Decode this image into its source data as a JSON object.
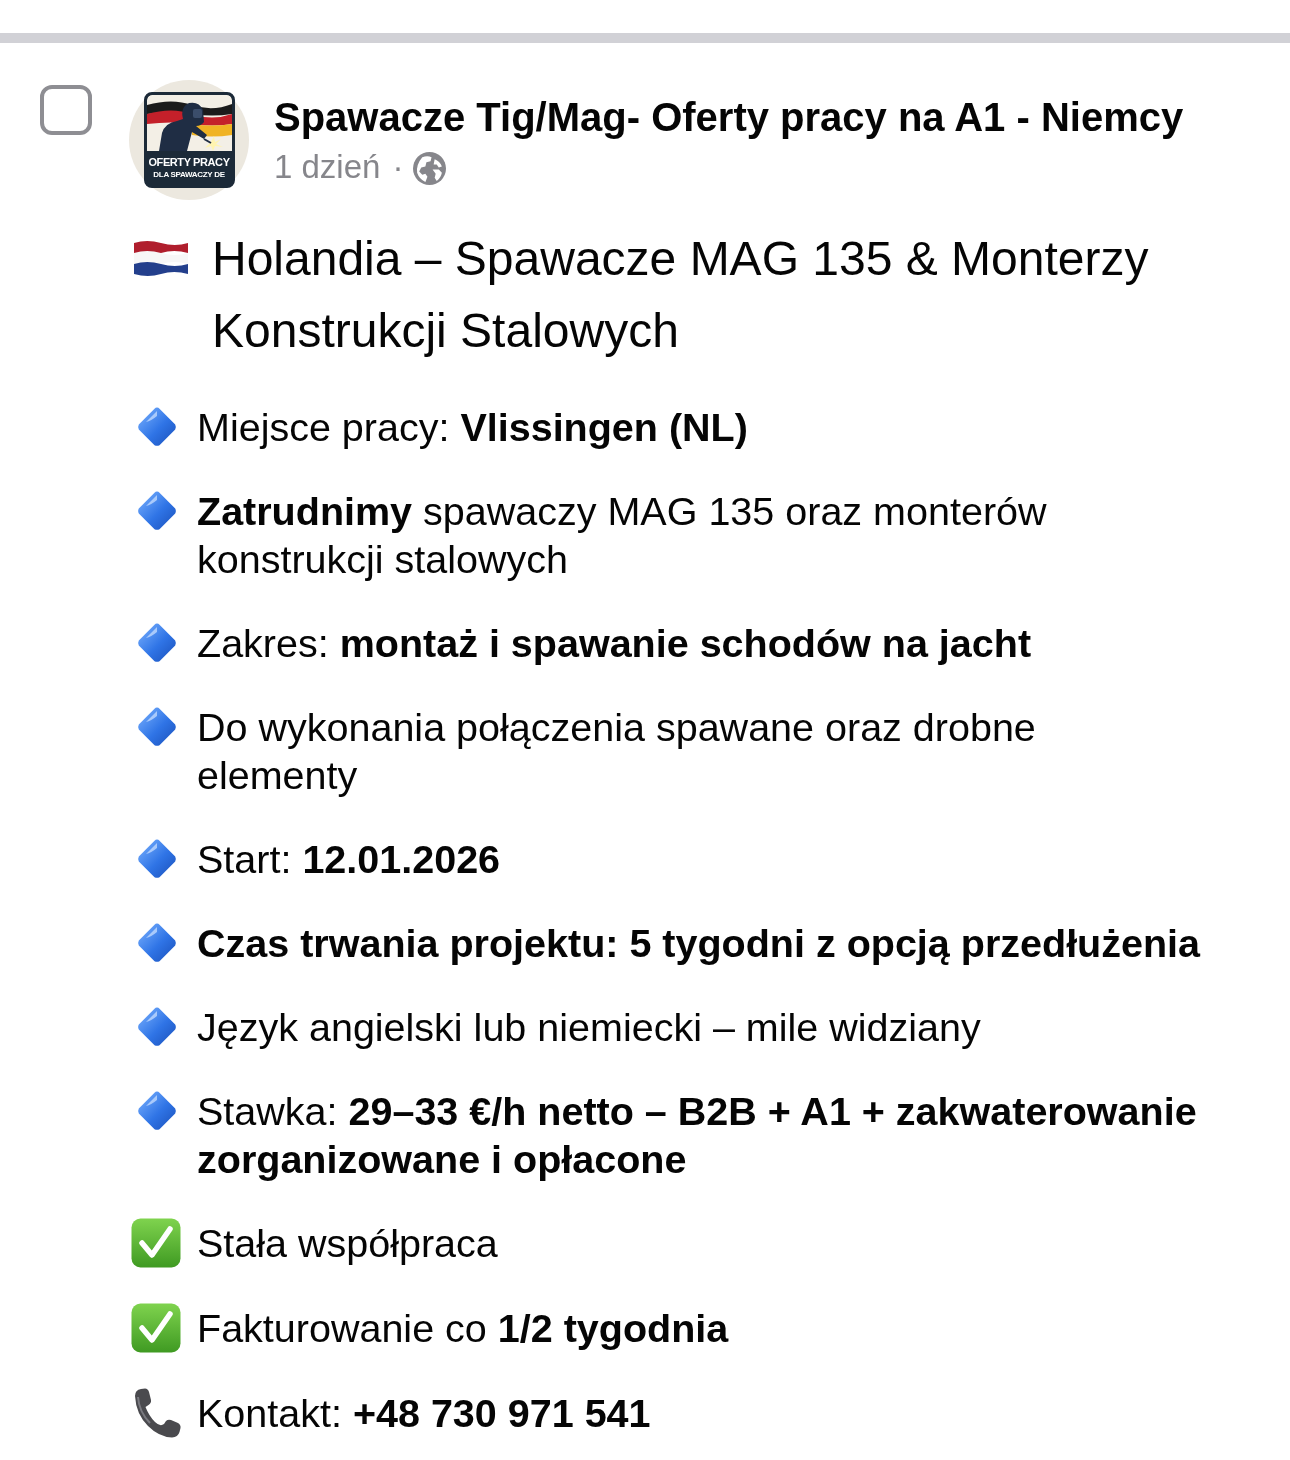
{
  "post": {
    "select_checkbox": {
      "checked": false
    },
    "group": {
      "name": "Spawacze Tig/Mag- Oferty pracy na A1 - Niemcy",
      "logo_lines": [
        "OFERTY PRACY",
        "DLA SPAWACZY DE"
      ]
    },
    "meta": {
      "time": "1 dzień",
      "separator": "·"
    },
    "headline": "Holandia – Spawacze MAG 135 & Monterzy Konstrukcji Stalowych",
    "paragraphs": [
      {
        "kind": "detail",
        "bold": false,
        "text": "Miejsce pracy: **Vlissingen (NL)**"
      },
      {
        "kind": "detail",
        "bold": false,
        "text": "**Zatrudnimy** spawaczy MAG 135 oraz monterów konstrukcji stalowych"
      },
      {
        "kind": "detail",
        "bold": false,
        "text": "Zakres: **montaż i spawanie schodów na jacht**"
      },
      {
        "kind": "detail",
        "bold": false,
        "text": "Do wykonania połączenia spawane oraz drobne elementy"
      },
      {
        "kind": "detail",
        "bold": false,
        "text": "Start: **12.01.2026**"
      },
      {
        "kind": "detail",
        "bold": true,
        "text": "Czas trwania projektu: 5 tygodni z opcją przedłużenia"
      },
      {
        "kind": "detail",
        "bold": false,
        "text": "Język angielski lub niemiecki – mile widziany"
      },
      {
        "kind": "detail",
        "bold": false,
        "text": "Stawka: **29–33 €/h netto – B2B + A1 + zakwaterowanie zorganizowane i opłacone**"
      },
      {
        "kind": "benefit",
        "bold": false,
        "text": "Stała współpraca"
      },
      {
        "kind": "benefit",
        "bold": false,
        "text": "Fakturowanie co **1/2 tygodnia**"
      },
      {
        "kind": "contact",
        "bold": false,
        "text": "Kontakt: **+48 730 971 541**"
      }
    ]
  }
}
